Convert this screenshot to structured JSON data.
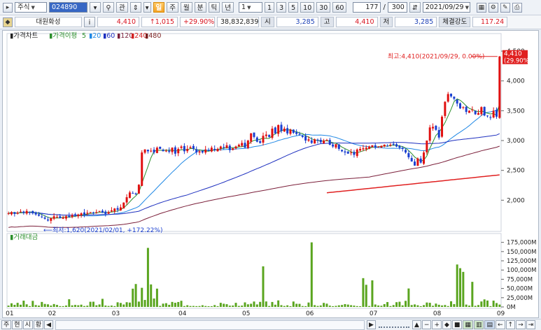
{
  "toolbar": {
    "market": "주식",
    "code": "024890",
    "search_icon": "magnifier-icon",
    "gwan": "관",
    "period_active": "일",
    "periods": [
      "주",
      "월",
      "분",
      "틱",
      "년"
    ],
    "interval": "1",
    "interval_buttons": [
      "1",
      "3",
      "5",
      "10",
      "30",
      "60"
    ],
    "count": "177",
    "slash": "/",
    "total": "300",
    "date": "2021/09/29"
  },
  "quote": {
    "name": "대원화성",
    "info": "i",
    "price": "4,410",
    "change": "↑1,015",
    "rate": "+29.90%",
    "volume": "38,832,839",
    "open_label": "시",
    "open": "3,285",
    "high_label": "고",
    "high": "4,410",
    "low_label": "저",
    "low": "3,285",
    "strength_label": "체결강도",
    "strength": "117.24"
  },
  "chart_data": [
    {
      "type": "candlestick",
      "legend": {
        "price_label": "가격차트",
        "ma_label": "가격이평",
        "ma_periods": [
          "5",
          "20",
          "60",
          "120",
          "240",
          "480"
        ]
      },
      "y_ticks": [
        "4,500",
        "4,000",
        "3,500",
        "3,000",
        "2,500",
        "2,000"
      ],
      "ylim": [
        1500,
        4700
      ],
      "x_ticks": [
        "01",
        "02",
        "03",
        "04",
        "05",
        "06",
        "07",
        "08",
        "09"
      ],
      "current_price": "4,410",
      "current_rate": "(29.90%)",
      "annotations": {
        "max": "최고:4,410(2021/09/29, 0.00%)",
        "min": "최저:1,620(2021/02/01, +172.22%)"
      },
      "closes": [
        1780,
        1800,
        1770,
        1790,
        1810,
        1790,
        1820,
        1800,
        1780,
        1760,
        1740,
        1720,
        1690,
        1660,
        1700,
        1730,
        1720,
        1700,
        1710,
        1730,
        1720,
        1750,
        1740,
        1760,
        1780,
        1760,
        1790,
        1800,
        1780,
        1800,
        1820,
        1790,
        1770,
        1800,
        1830,
        1860,
        1840,
        1880,
        1960,
        2050,
        2130,
        2120,
        2100,
        2260,
        2800,
        2850,
        2820,
        2830,
        2800,
        2880,
        2860,
        2820,
        2830,
        2810,
        2880,
        2780,
        2860,
        2900,
        2820,
        2860,
        2890,
        2860,
        2800,
        2820,
        2800,
        2850,
        2830,
        2880,
        2840,
        2860,
        2900,
        2880,
        2920,
        2840,
        2870,
        2900,
        2930,
        2960,
        2880,
        3000,
        3120,
        3060,
        2980,
        2960,
        3080,
        3100,
        3060,
        3200,
        3120,
        3260,
        3160,
        3200,
        3120,
        3180,
        3130,
        3110,
        3100,
        3060,
        3000,
        3020,
        2960,
        3020,
        3000,
        2970,
        3000,
        3010,
        2930,
        2900,
        2940,
        2860,
        2820,
        2800,
        2780,
        2800,
        2760,
        2850,
        2860,
        2870,
        2880,
        2900,
        2920,
        2880,
        2900,
        2910,
        2930,
        2910,
        2930,
        2930,
        2900,
        2880,
        2860,
        2800,
        2720,
        2650,
        2580,
        2700,
        2630,
        2800,
        3000,
        3220,
        3230,
        3180,
        3050,
        3400,
        3650,
        3780,
        3740,
        3700,
        3620,
        3540,
        3560,
        3480,
        3500,
        3520,
        3440,
        3460,
        3560,
        3420,
        3410,
        3380,
        3500,
        3400,
        4410
      ],
      "volume_axis": [
        "175,000M",
        "150,000M",
        "125,000M",
        "100,000M",
        "75,000M",
        "50,000M",
        "25,000M",
        "0M"
      ],
      "volume_ylim": [
        0,
        180000
      ],
      "volume_label": "거래대금"
    }
  ],
  "bottom": {
    "tabs": [
      "주",
      "현",
      "시",
      "황"
    ],
    "nav": [
      "◀",
      "▶",
      "−",
      "+",
      "◆",
      "■",
      "←",
      "↑",
      "→",
      "⇥"
    ]
  }
}
